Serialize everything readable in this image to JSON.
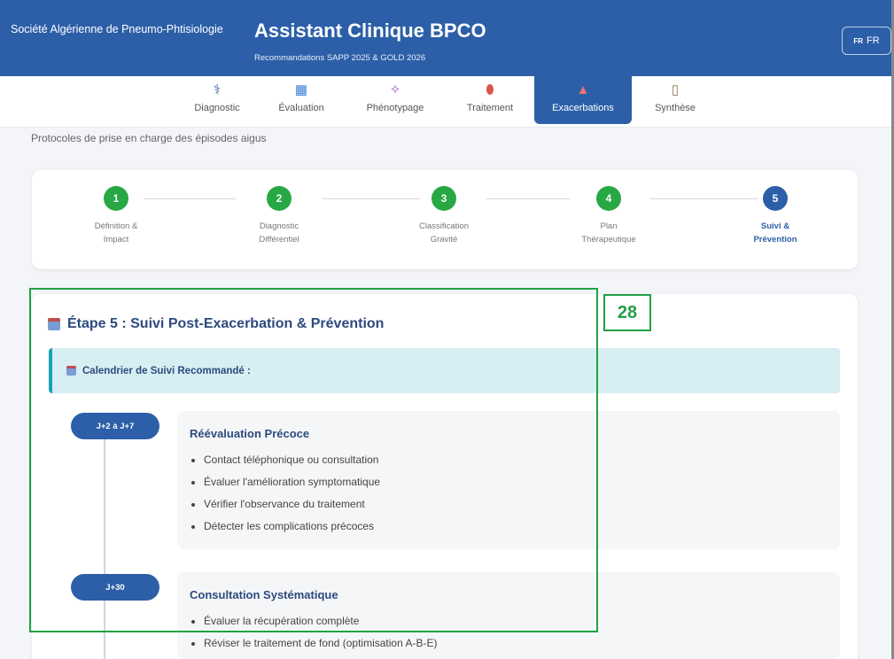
{
  "header": {
    "org_name": "Société Algérienne de Pneumo-Phtisiologie",
    "app_title": "Assistant Clinique BPCO",
    "app_subtitle": "Recommandations SAPP 2025 & GOLD 2026",
    "lang_flag": "FR",
    "lang_label": "FR"
  },
  "tabs": [
    {
      "label": "Diagnostic",
      "icon": "stethoscope-icon"
    },
    {
      "label": "Évaluation",
      "icon": "chart-icon"
    },
    {
      "label": "Phénotypage",
      "icon": "dna-icon"
    },
    {
      "label": "Traitement",
      "icon": "pill-icon"
    },
    {
      "label": "Exacerbations",
      "icon": "siren-icon",
      "active": true
    },
    {
      "label": "Synthèse",
      "icon": "clipboard-icon"
    }
  ],
  "page_description": "Protocoles de prise en charge des épisodes aigus",
  "steps": [
    {
      "number": "1",
      "line1": "Définition &",
      "line2": "Impact",
      "state": "done"
    },
    {
      "number": "2",
      "line1": "Diagnostic",
      "line2": "Différentiel",
      "state": "done"
    },
    {
      "number": "3",
      "line1": "Classification",
      "line2": "Gravité",
      "state": "done"
    },
    {
      "number": "4",
      "line1": "Plan",
      "line2": "Thérapeutique",
      "state": "done"
    },
    {
      "number": "5",
      "line1": "Suivi &",
      "line2": "Prévention",
      "state": "current"
    }
  ],
  "stage": {
    "title": "Étape 5 : Suivi Post-Exacerbation & Prévention",
    "calendar_heading": "Calendrier de Suivi Recommandé :"
  },
  "timeline": [
    {
      "badge": "J+2 à J+7",
      "title": "Réévaluation Précoce",
      "items": [
        "Contact téléphonique ou consultation",
        "Évaluer l'amélioration symptomatique",
        "Vérifier l'observance du traitement",
        "Détecter les complications précoces"
      ]
    },
    {
      "badge": "J+30",
      "title": "Consultation Systématique",
      "items": [
        "Évaluer la récupération complète",
        "Réviser le traitement de fond (optimisation A-B-E)"
      ]
    }
  ],
  "annotation": {
    "label": "28",
    "color": "#22a046"
  },
  "colors": {
    "primary": "#2c5fa8",
    "success": "#27a844",
    "info": "#17a2b8"
  }
}
